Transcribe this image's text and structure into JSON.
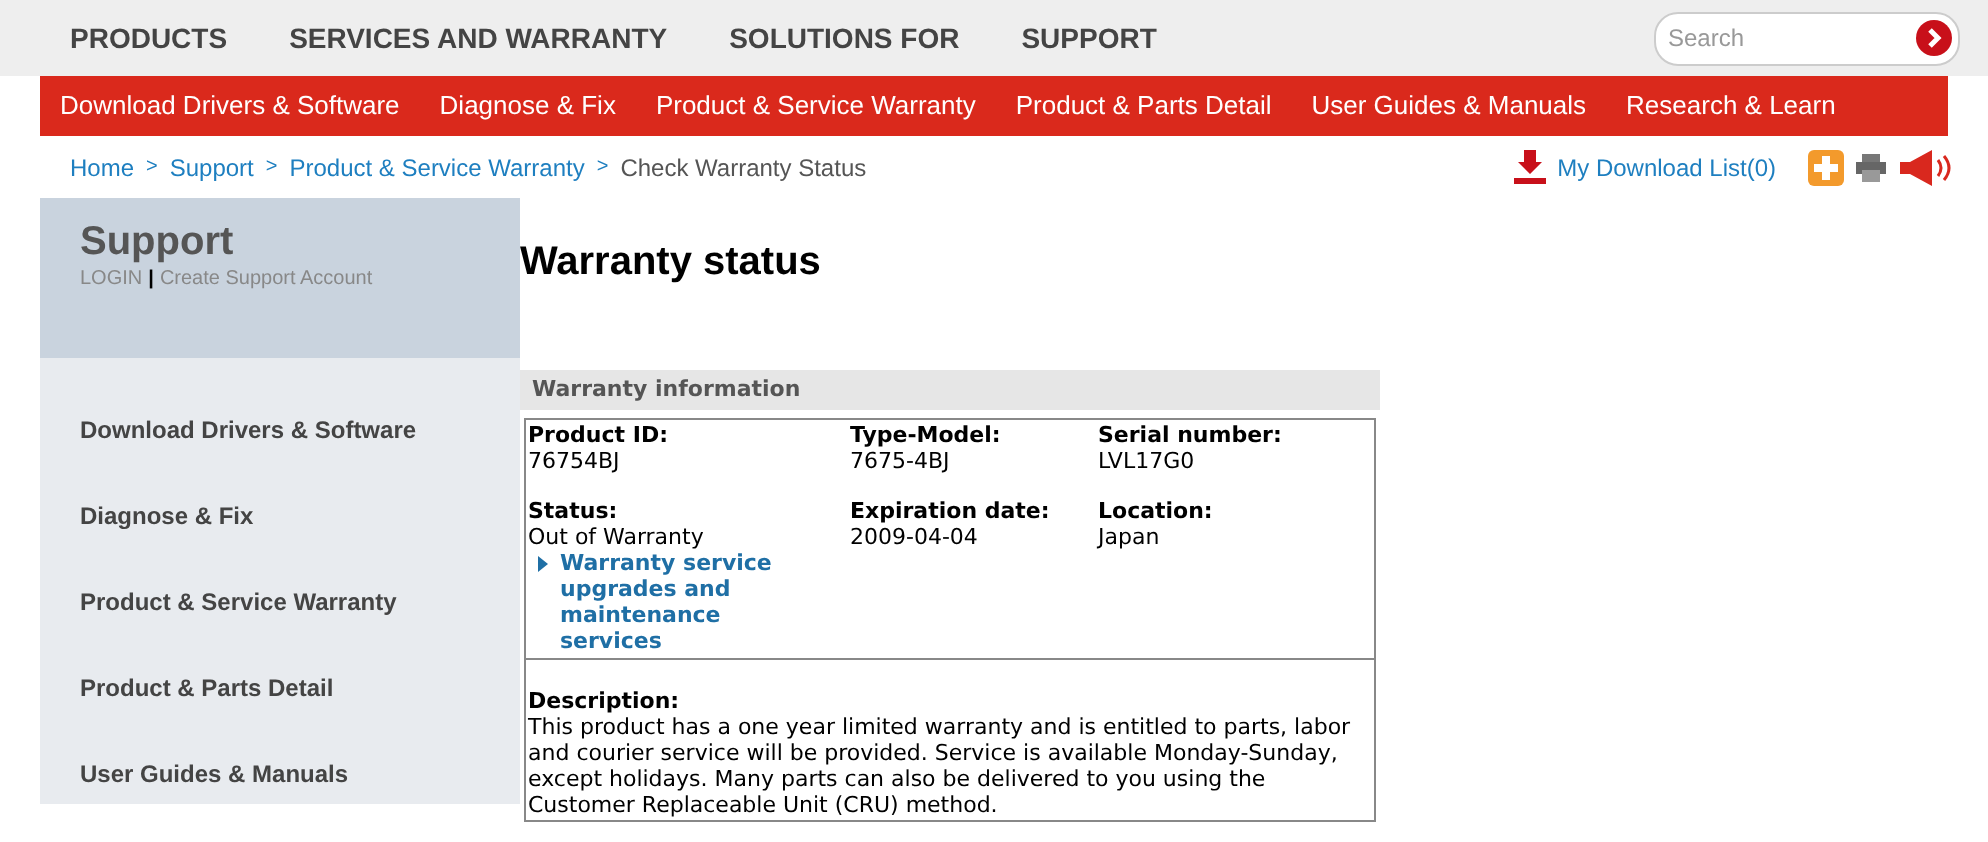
{
  "top_nav": [
    "PRODUCTS",
    "SERVICES AND WARRANTY",
    "SOLUTIONS FOR",
    "SUPPORT"
  ],
  "search": {
    "placeholder": "Search"
  },
  "sub_nav": [
    "Download Drivers & Software",
    "Diagnose & Fix",
    "Product & Service Warranty",
    "Product & Parts Detail",
    "User Guides & Manuals",
    "Research & Learn"
  ],
  "breadcrumb": [
    {
      "label": "Home",
      "link": true
    },
    {
      "separator": ">",
      "label": "Support",
      "link": true
    },
    {
      "separator": ">",
      "label": "Product & Service Warranty",
      "link": true
    },
    {
      "separator": ">",
      "label": "Check Warranty Status",
      "link": false
    }
  ],
  "download_list": "My Download List(0)",
  "sidebar": {
    "title": "Support",
    "login": "LOGIN",
    "separator": "|",
    "create_account": "Create Support Account",
    "items": [
      "Download Drivers & Software",
      "Diagnose & Fix",
      "Product & Service Warranty",
      "Product & Parts Detail",
      "User Guides & Manuals"
    ]
  },
  "page_title": "Warranty status",
  "panel": {
    "title": "Warranty information",
    "fields": [
      {
        "label": "Product ID:",
        "value": "76754BJ"
      },
      {
        "label": "Type-Model:",
        "value": "7675-4BJ"
      },
      {
        "label": "Serial number:",
        "value": "LVL17G0"
      },
      {
        "label": "Status:",
        "value": "Out of Warranty",
        "link": "Warranty service upgrades and maintenance services"
      },
      {
        "label": "Expiration date:",
        "value": "2009-04-04"
      },
      {
        "label": "Location:",
        "value": "Japan"
      }
    ],
    "description_label": "Description:",
    "description": "This product has a one year limited warranty and is entitled to parts, labor and courier service will be provided. Service is available Monday-Sunday, except holidays. Many parts can also be delivered to you using the Customer Replaceable Unit (CRU) method."
  }
}
